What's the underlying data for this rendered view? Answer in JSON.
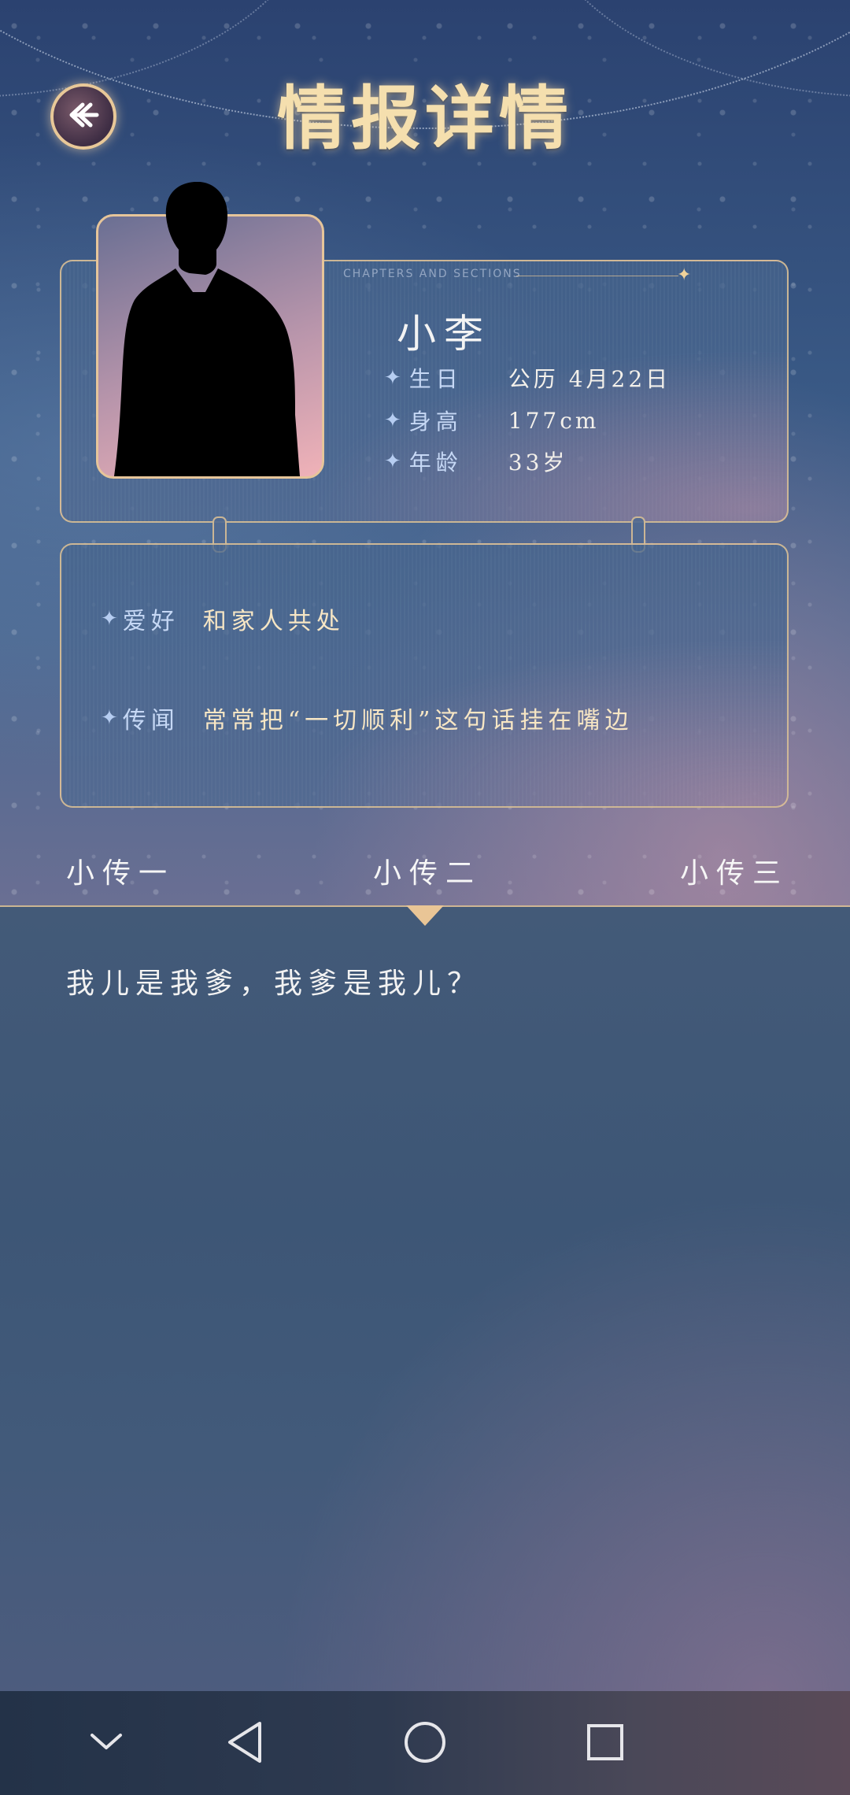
{
  "header": {
    "title": "情报详情",
    "back_icon": "back-arrow-icon"
  },
  "profile": {
    "chapters_label": "CHAPTERS AND SECTIONS",
    "name": "小李",
    "rows": [
      {
        "label": "生日",
        "value": "公历 4月22日"
      },
      {
        "label": "身高",
        "value": "177cm"
      },
      {
        "label": "年龄",
        "value": "33岁"
      }
    ]
  },
  "details": [
    {
      "label": "爱好",
      "value": "和家人共处"
    },
    {
      "label": "传闻",
      "value": "常常把“一切顺利”这句话挂在嘴边"
    }
  ],
  "tabs": [
    {
      "label": "小传一"
    },
    {
      "label": "小传二"
    },
    {
      "label": "小传三"
    }
  ],
  "selected_tab": "小传二",
  "story": {
    "text": "我儿是我爹，我爹是我儿？"
  },
  "nav": {
    "icons": [
      "chevron-down-icon",
      "back-triangle-icon",
      "home-circle-icon",
      "recents-square-icon"
    ]
  },
  "colors": {
    "accent_gold": "#f5dfae",
    "border_gold": "#e6c59a",
    "panel_blue": "#3d5676"
  }
}
